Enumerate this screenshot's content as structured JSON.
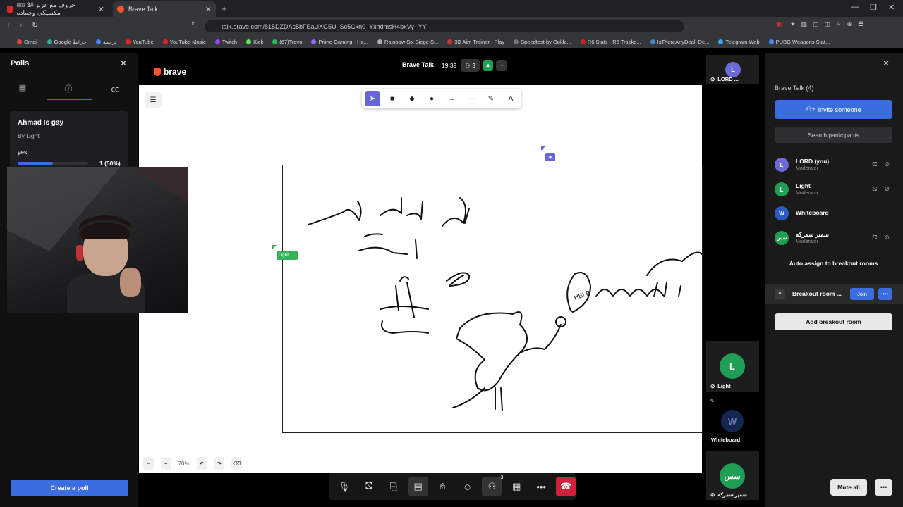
{
  "browser": {
    "tabs": [
      {
        "title": "حروف مع عزيز #3 🎟 مكسيكي وجماده",
        "active": false
      },
      {
        "title": "Brave Talk",
        "active": true
      }
    ],
    "url": "talk.brave.com/815DZDAc5bFEaUXG5U_Sc5Cxn0_YxhdmsH4bxVy--YY",
    "bookmarks": [
      "Gmail",
      "Google خرائط",
      "ترجمة",
      "YouTube",
      "YouTube Music",
      "Twitch",
      "Kick",
      "(67)Trovo",
      "Prime Gaming - Ho...",
      "Rainbow Six Siege S...",
      "3D Aim Trainer - Play",
      "Speedtest by Ookla...",
      "R6 Stats - R6 Tracke...",
      "IsThereAnyDeal: De...",
      "Telegram Web",
      "PUBG Weapons Stat..."
    ]
  },
  "polls": {
    "title": "Polls",
    "question": "Ahmad Is gay",
    "author": "By Light",
    "option": "yes",
    "votes_label": "1 (50%)",
    "fill_fraction": 0.5,
    "create_label": "Create a poll"
  },
  "meeting": {
    "brand": "brave",
    "room_title": "Brave Talk",
    "clock": "19:39",
    "participant_count": "3",
    "zoom": "70%",
    "light_cursor_label": "Light",
    "participants_badge": "3"
  },
  "tiles": {
    "top_name": "LORD ...",
    "top_initial": "L",
    "light_name": "Light",
    "light_initial": "L",
    "wb_initial": "W",
    "wb_name": "Whiteboard",
    "bottom_initial": "سس",
    "bottom_name": "سمير سمركه"
  },
  "panel": {
    "title": "Brave Talk (4)",
    "invite_label": "Invite someone",
    "search_label": "Search participants",
    "participants": [
      {
        "initial": "L",
        "name": "LORD (you)",
        "role": "Moderator",
        "color": "#6b6bd6"
      },
      {
        "initial": "L",
        "name": "Light",
        "role": "Moderator",
        "color": "#1f9e55"
      },
      {
        "initial": "W",
        "name": "Whiteboard",
        "role": "",
        "color": "#2d5bc4"
      },
      {
        "initial": "سس",
        "name": "سمير سمركه",
        "role": "Moderator",
        "color": "#1f9e55"
      }
    ],
    "auto_assign": "Auto assign to breakout rooms",
    "breakout_name": "Breakout room ...",
    "join_label": "Join",
    "add_breakout": "Add breakout room",
    "mute_all": "Mute all"
  },
  "colors": {
    "accent": "#3b6de0",
    "hangup": "#d0203a",
    "green": "#1f9e55",
    "toolbar_active": "#6965db"
  }
}
